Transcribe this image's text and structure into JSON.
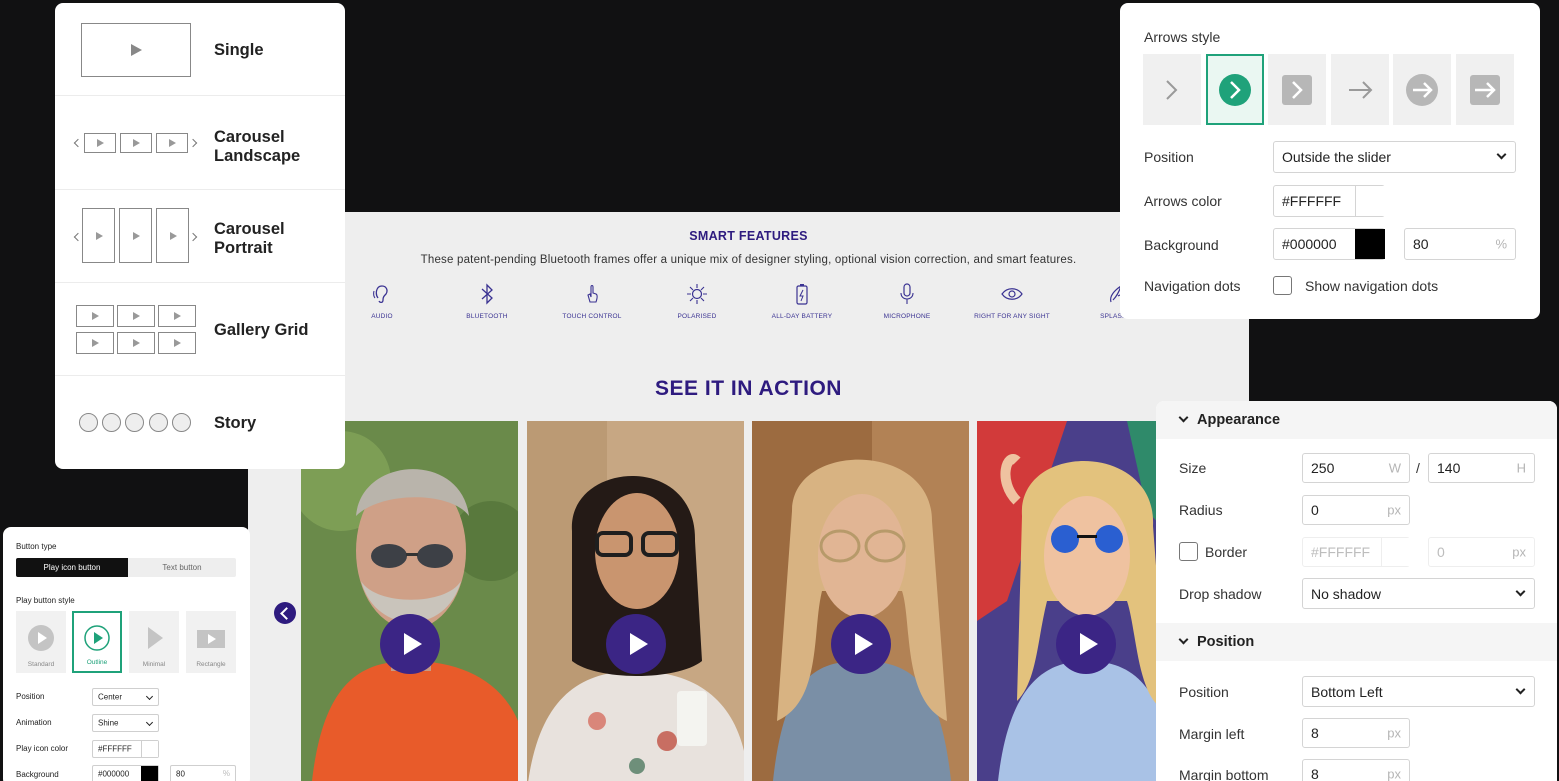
{
  "layout_card": {
    "options": [
      {
        "label": "Single",
        "icon": "single-layout-icon"
      },
      {
        "label": "Carousel\nLandscape",
        "icon": "carousel-landscape-icon"
      },
      {
        "label": "Carousel\nPortrait",
        "icon": "carousel-portrait-icon"
      },
      {
        "label": "Gallery Grid",
        "icon": "gallery-grid-icon"
      },
      {
        "label": "Story",
        "icon": "story-circles-icon"
      }
    ]
  },
  "preview": {
    "features_heading": "SMART FEATURES",
    "features_sub": "These patent-pending Bluetooth frames offer a unique mix of designer styling, optional vision correction, and smart features.",
    "features": [
      {
        "label": "AUDIO",
        "icon": "ear-icon"
      },
      {
        "label": "BLUETOOTH",
        "icon": "bluetooth-icon"
      },
      {
        "label": "TOUCH CONTROL",
        "icon": "touch-hand-icon"
      },
      {
        "label": "POLARISED",
        "icon": "sun-icon"
      },
      {
        "label": "ALL-DAY BATTERY",
        "icon": "battery-icon"
      },
      {
        "label": "MICROPHONE",
        "icon": "microphone-icon"
      },
      {
        "label": "RIGHT FOR ANY SIGHT",
        "icon": "eye-icon"
      },
      {
        "label": "SPLASH R",
        "icon": "splash-icon"
      }
    ],
    "action_heading": "SEE IT IN ACTION",
    "accent_color": "#2E1B7F"
  },
  "arrows_card": {
    "title": "Arrows style",
    "selected_style_index": 1,
    "position_label": "Position",
    "position_value": "Outside the slider",
    "arrows_color_label": "Arrows color",
    "arrows_color_value": "#FFFFFF",
    "background_label": "Background",
    "background_value": "#000000",
    "background_opacity": "80",
    "percent_unit": "%",
    "nav_dots_label": "Navigation dots",
    "nav_dots_checkbox": "Show navigation dots",
    "accent": "#1FA27A"
  },
  "button_card": {
    "button_type_label": "Button type",
    "segments": [
      "Play icon button",
      "Text button"
    ],
    "play_style_label": "Play button style",
    "styles": [
      "Standard",
      "Outline",
      "Minimal",
      "Rectangle"
    ],
    "position_label": "Position",
    "position_value": "Center",
    "animation_label": "Animation",
    "animation_value": "Shine",
    "icon_color_label": "Play icon color",
    "icon_color_value": "#FFFFFF",
    "background_label": "Background",
    "background_value": "#000000",
    "background_opacity": "80",
    "percent_unit": "%"
  },
  "appearance_card": {
    "appearance_title": "Appearance",
    "size_label": "Size",
    "size_w": "250",
    "w_unit": "W",
    "size_sep": "/",
    "size_h": "140",
    "h_unit": "H",
    "radius_label": "Radius",
    "radius_value": "0",
    "px_unit": "px",
    "border_label": "Border",
    "border_color": "#FFFFFF",
    "border_width": "0",
    "drop_shadow_label": "Drop shadow",
    "drop_shadow_value": "No shadow",
    "position_title": "Position",
    "position_label": "Position",
    "position_value": "Bottom Left",
    "margin_left_label": "Margin left",
    "margin_left_value": "8",
    "margin_bottom_label": "Margin bottom",
    "margin_bottom_value": "8"
  }
}
